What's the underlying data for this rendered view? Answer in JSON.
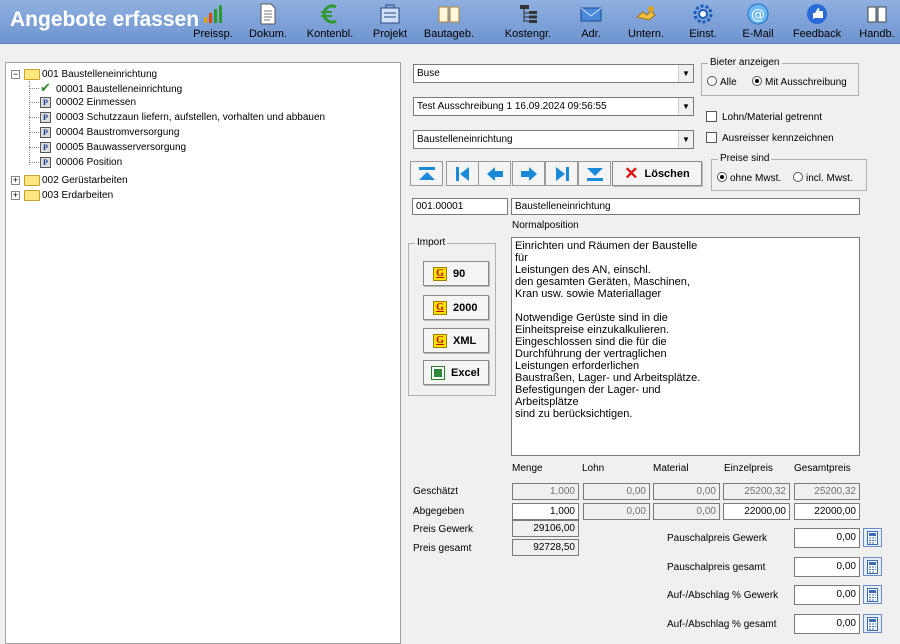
{
  "app": {
    "title": "Angebote erfassen"
  },
  "toolbar": [
    {
      "label": "Preissp.",
      "icon": "bar-chart-icon"
    },
    {
      "label": "Dokum.",
      "icon": "document-icon"
    },
    {
      "label": "Kontenbl.",
      "icon": "euro-icon"
    },
    {
      "label": "Projekt",
      "icon": "project-icon"
    },
    {
      "label": "Bautageb.",
      "icon": "book-icon"
    },
    {
      "label": "Kostengr.",
      "icon": "hierarchy-icon"
    },
    {
      "label": "Adr.",
      "icon": "envelope-icon"
    },
    {
      "label": "Untern.",
      "icon": "handshake-icon"
    },
    {
      "label": "Einst.",
      "icon": "gear-icon"
    },
    {
      "label": "E-Mail",
      "icon": "at-sign-icon"
    },
    {
      "label": "Feedback",
      "icon": "thumbs-up-icon"
    },
    {
      "label": "Handb.",
      "icon": "manual-icon"
    }
  ],
  "tree": {
    "n1": "001 Baustelleneinrichtung",
    "n1c1": "00001 Baustelleneinrichtung",
    "n1c2": "00002 Einmessen",
    "n1c3": "00003 Schutzzaun liefern, aufstellen, vorhalten und abbauen",
    "n1c4": "00004 Baustromversorgung",
    "n1c5": "00005 Bauwasserversorgung",
    "n1c6": "00006 Position",
    "n2": "002 Gerüstarbeiten",
    "n3": "003 Erdarbeiten",
    "p_marker": "P"
  },
  "selectors": {
    "bidder": "Buse",
    "tender": "Test Ausschreibung 1 16.09.2024 09:56:55",
    "section": "Baustelleneinrichtung"
  },
  "bieter": {
    "title": "Bieter anzeigen",
    "alle": "Alle",
    "mit": "Mit Ausschreibung"
  },
  "options": {
    "lohn": "Lohn/Material getrennt",
    "ausreisser": "Ausreisser kennzeichnen"
  },
  "preise": {
    "title": "Preise sind",
    "ohne": "ohne Mwst.",
    "incl": "incl. Mwst."
  },
  "nav": {
    "delete_label": "Löschen"
  },
  "position": {
    "number": "001.00001",
    "name": "Baustelleneinrichtung",
    "type": "Normalposition",
    "text": "Einrichten und Räumen der Baustelle\nfür\nLeistungen des AN, einschl.\nden gesamten Geräten, Maschinen,\nKran usw. sowie Materiallager\n\nNotwendige Gerüste sind in die\nEinheitspreise einzukalkulieren.\nEingeschlossen sind die für die\nDurchführung der vertraglichen\nLeistungen erforderlichen\nBaustraßen, Lager- und Arbeitsplätze.\nBefestigungen der Lager- und\nArbeitsplätze\nsind zu berücksichtigen."
  },
  "import": {
    "title": "Import",
    "g_icon": "G",
    "btn90": "90",
    "btn2000": "2000",
    "btnxml": "XML",
    "btnexcel": "Excel"
  },
  "prices": {
    "headers": {
      "menge": "Menge",
      "lohn": "Lohn",
      "material": "Material",
      "einzel": "Einzelpreis",
      "gesamt": "Gesamtpreis"
    },
    "geschaetzt": {
      "label": "Geschätzt",
      "menge": "1,000",
      "lohn": "0,00",
      "material": "0,00",
      "einzel": "25200,32",
      "gesamt": "25200,32"
    },
    "abgegeben": {
      "label": "Abgegeben",
      "menge": "1,000",
      "lohn": "0,00",
      "material": "0,00",
      "einzel": "22000,00",
      "gesamt": "22000,00"
    },
    "gewerk": {
      "label": "Preis Gewerk",
      "value": "29106,00"
    },
    "total": {
      "label": "Preis gesamt",
      "value": "92728,50"
    }
  },
  "pauschal": {
    "gewerk": {
      "label": "Pauschalpreis Gewerk",
      "value": "0,00"
    },
    "gesamt": {
      "label": "Pauschalpreis gesamt",
      "value": "0,00"
    },
    "auf_gewerk": {
      "label": "Auf-/Abschlag % Gewerk",
      "value": "0,00"
    },
    "auf_gesamt": {
      "label": "Auf-/Abschlag % gesamt",
      "value": "0,00"
    }
  }
}
